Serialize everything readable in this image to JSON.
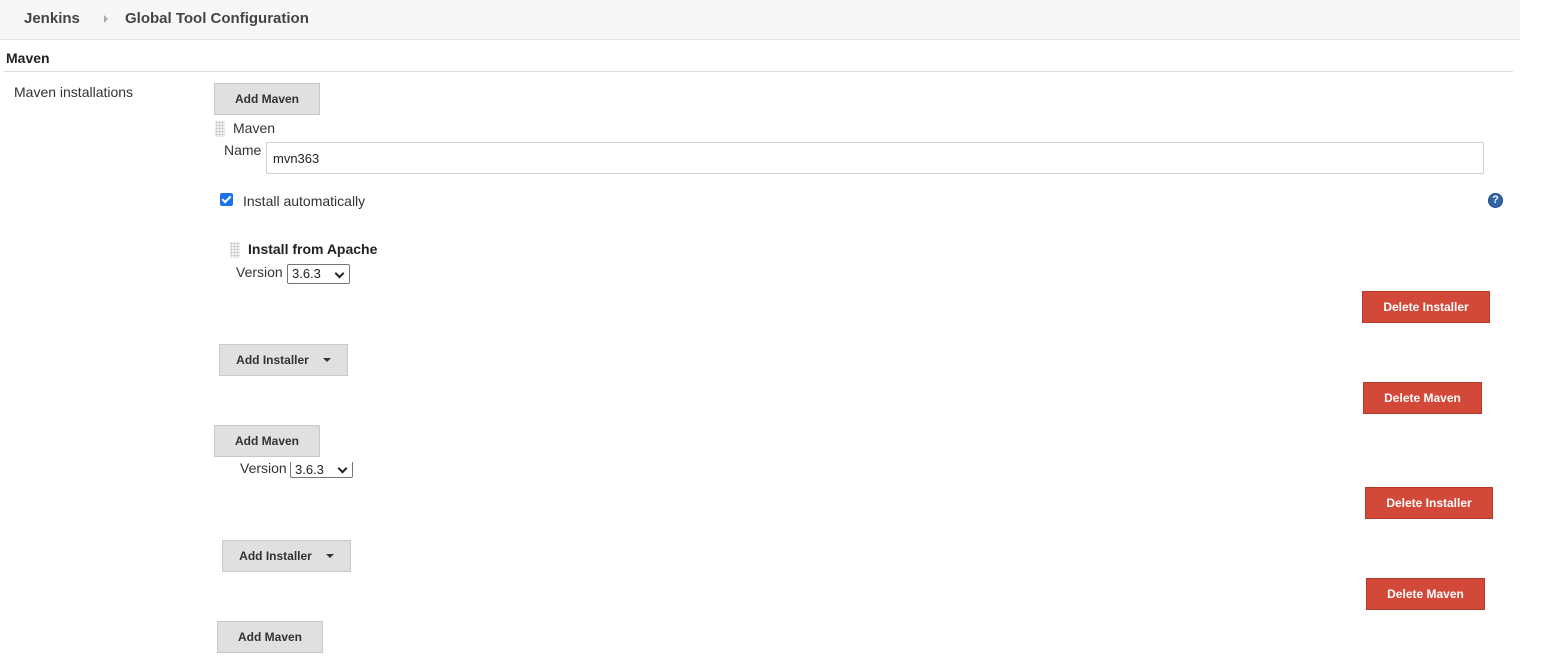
{
  "breadcrumb": {
    "root": "Jenkins",
    "current": "Global Tool Configuration"
  },
  "section": {
    "title": "Maven"
  },
  "maven_installations": {
    "label": "Maven installations",
    "add_button": "Add Maven",
    "item_title": "Maven",
    "name_label": "Name",
    "name_value": "mvn363",
    "install_automatically_label": "Install automatically",
    "install_automatically_checked": true,
    "installer_title": "Install from Apache",
    "version_label": "Version",
    "version_value": "3.6.3",
    "delete_installer": "Delete Installer",
    "add_installer": "Add Installer",
    "delete_maven": "Delete Maven",
    "help_icon": "?"
  },
  "colors": {
    "danger": "#d24939",
    "secondary": "#e0e0e0",
    "help": "#2f64a6",
    "checkbox": "#1a73e8"
  },
  "icons": [
    "chevron-right-icon",
    "drag-handle-icon",
    "help-icon",
    "caret-down-icon",
    "checkbox-checked-icon"
  ]
}
